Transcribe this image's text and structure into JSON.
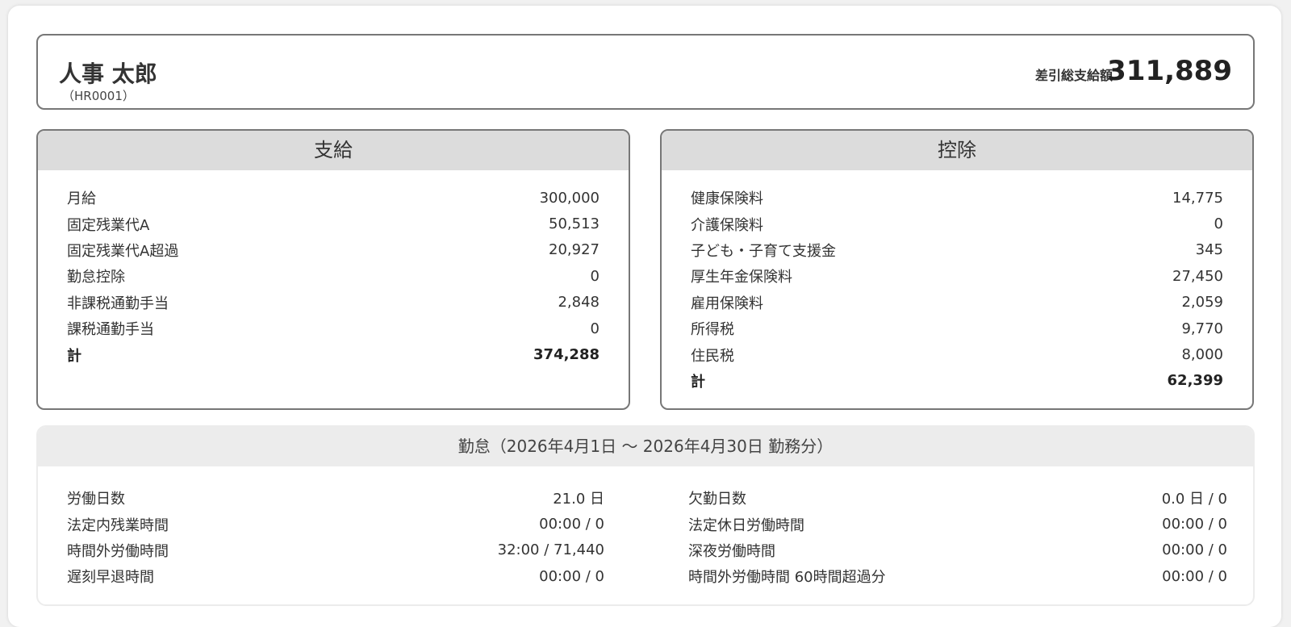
{
  "employee": {
    "name": "人事 太郎",
    "code": "（HR0001）"
  },
  "net_pay": {
    "label": "差引総支給額",
    "value": "311,889"
  },
  "payments": {
    "title": "支給",
    "items": [
      {
        "label": "月給",
        "value": "300,000"
      },
      {
        "label": "固定残業代A",
        "value": "50,513"
      },
      {
        "label": "固定残業代A超過",
        "value": "20,927"
      },
      {
        "label": "勤怠控除",
        "value": "0"
      },
      {
        "label": "非課税通勤手当",
        "value": "2,848"
      },
      {
        "label": "課税通勤手当",
        "value": "0"
      }
    ],
    "total": {
      "label": "計",
      "value": "374,288"
    }
  },
  "deductions": {
    "title": "控除",
    "items": [
      {
        "label": "健康保険料",
        "value": "14,775"
      },
      {
        "label": "介護保険料",
        "value": "0"
      },
      {
        "label": "子ども・子育て支援金",
        "value": "345"
      },
      {
        "label": "厚生年金保険料",
        "value": "27,450"
      },
      {
        "label": "雇用保険料",
        "value": "2,059"
      },
      {
        "label": "所得税",
        "value": "9,770"
      },
      {
        "label": "住民税",
        "value": "8,000"
      }
    ],
    "total": {
      "label": "計",
      "value": "62,399"
    }
  },
  "attendance": {
    "title": "勤怠（2026年4月1日 〜 2026年4月30日 勤務分）",
    "left": [
      {
        "label": "労働日数",
        "value": "21.0 日"
      },
      {
        "label": "法定内残業時間",
        "value": "00:00 / 0"
      },
      {
        "label": "時間外労働時間",
        "value": "32:00 / 71,440"
      },
      {
        "label": "遅刻早退時間",
        "value": "00:00 / 0"
      }
    ],
    "right": [
      {
        "label": "欠勤日数",
        "value": "0.0 日 / 0"
      },
      {
        "label": "法定休日労働時間",
        "value": "00:00 / 0"
      },
      {
        "label": "深夜労働時間",
        "value": "00:00 / 0"
      },
      {
        "label": "時間外労働時間 60時間超過分",
        "value": "00:00 / 0"
      }
    ]
  }
}
